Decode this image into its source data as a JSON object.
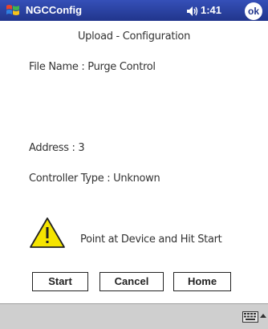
{
  "titlebar": {
    "start_icon": "windows-flag-icon",
    "app_title": "NGCConfig",
    "speaker_icon": "speaker-icon",
    "time": "1:41",
    "ok_label": "ok"
  },
  "form": {
    "heading": "Upload - Configuration",
    "file_name": "File Name :   Purge Control",
    "address": "Address : 3",
    "controller_type": "Controller Type : Unknown",
    "warning_icon": "warning-icon",
    "prompt": "Point at Device and Hit Start"
  },
  "buttons": {
    "start": "Start",
    "cancel": "Cancel",
    "home": "Home"
  },
  "menubar": {
    "keyboard_icon": "keyboard-icon"
  },
  "colors": {
    "titlebar": "#2a3f9e",
    "menubar": "#cfcfcf",
    "warning": "#f5e400"
  }
}
